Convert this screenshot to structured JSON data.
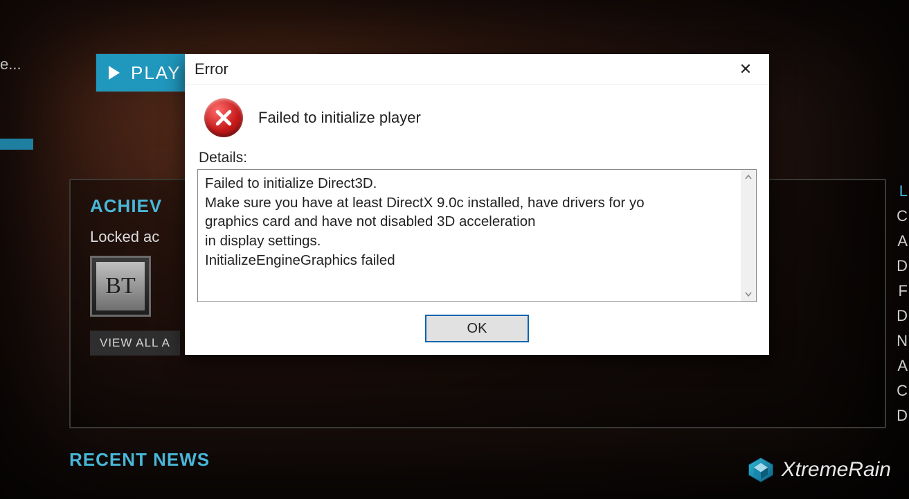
{
  "background": {
    "play_button_label": "PLAY",
    "left_edge_text": "e...",
    "achievements_header": "ACHIEV",
    "achievements_sub": "Locked ac",
    "achievement_tile_text": "BT",
    "view_all_label": "VIEW ALL A",
    "recent_news_header": "RECENT NEWS",
    "right_column": {
      "header": "L",
      "rows": [
        "C",
        "A",
        "D",
        "F",
        "D",
        "N",
        "A",
        "C",
        "D"
      ]
    }
  },
  "dialog": {
    "title": "Error",
    "close_glyph": "✕",
    "message": "Failed to initialize player",
    "details_label": "Details:",
    "details_lines": [
      "Failed to initialize Direct3D.",
      "Make sure you have at least DirectX 9.0c installed, have drivers for yo",
      "graphics card and have not disabled 3D acceleration",
      "in display settings.",
      "InitializeEngineGraphics failed"
    ],
    "ok_label": "OK"
  },
  "watermark": {
    "text": "XtremeRain"
  }
}
